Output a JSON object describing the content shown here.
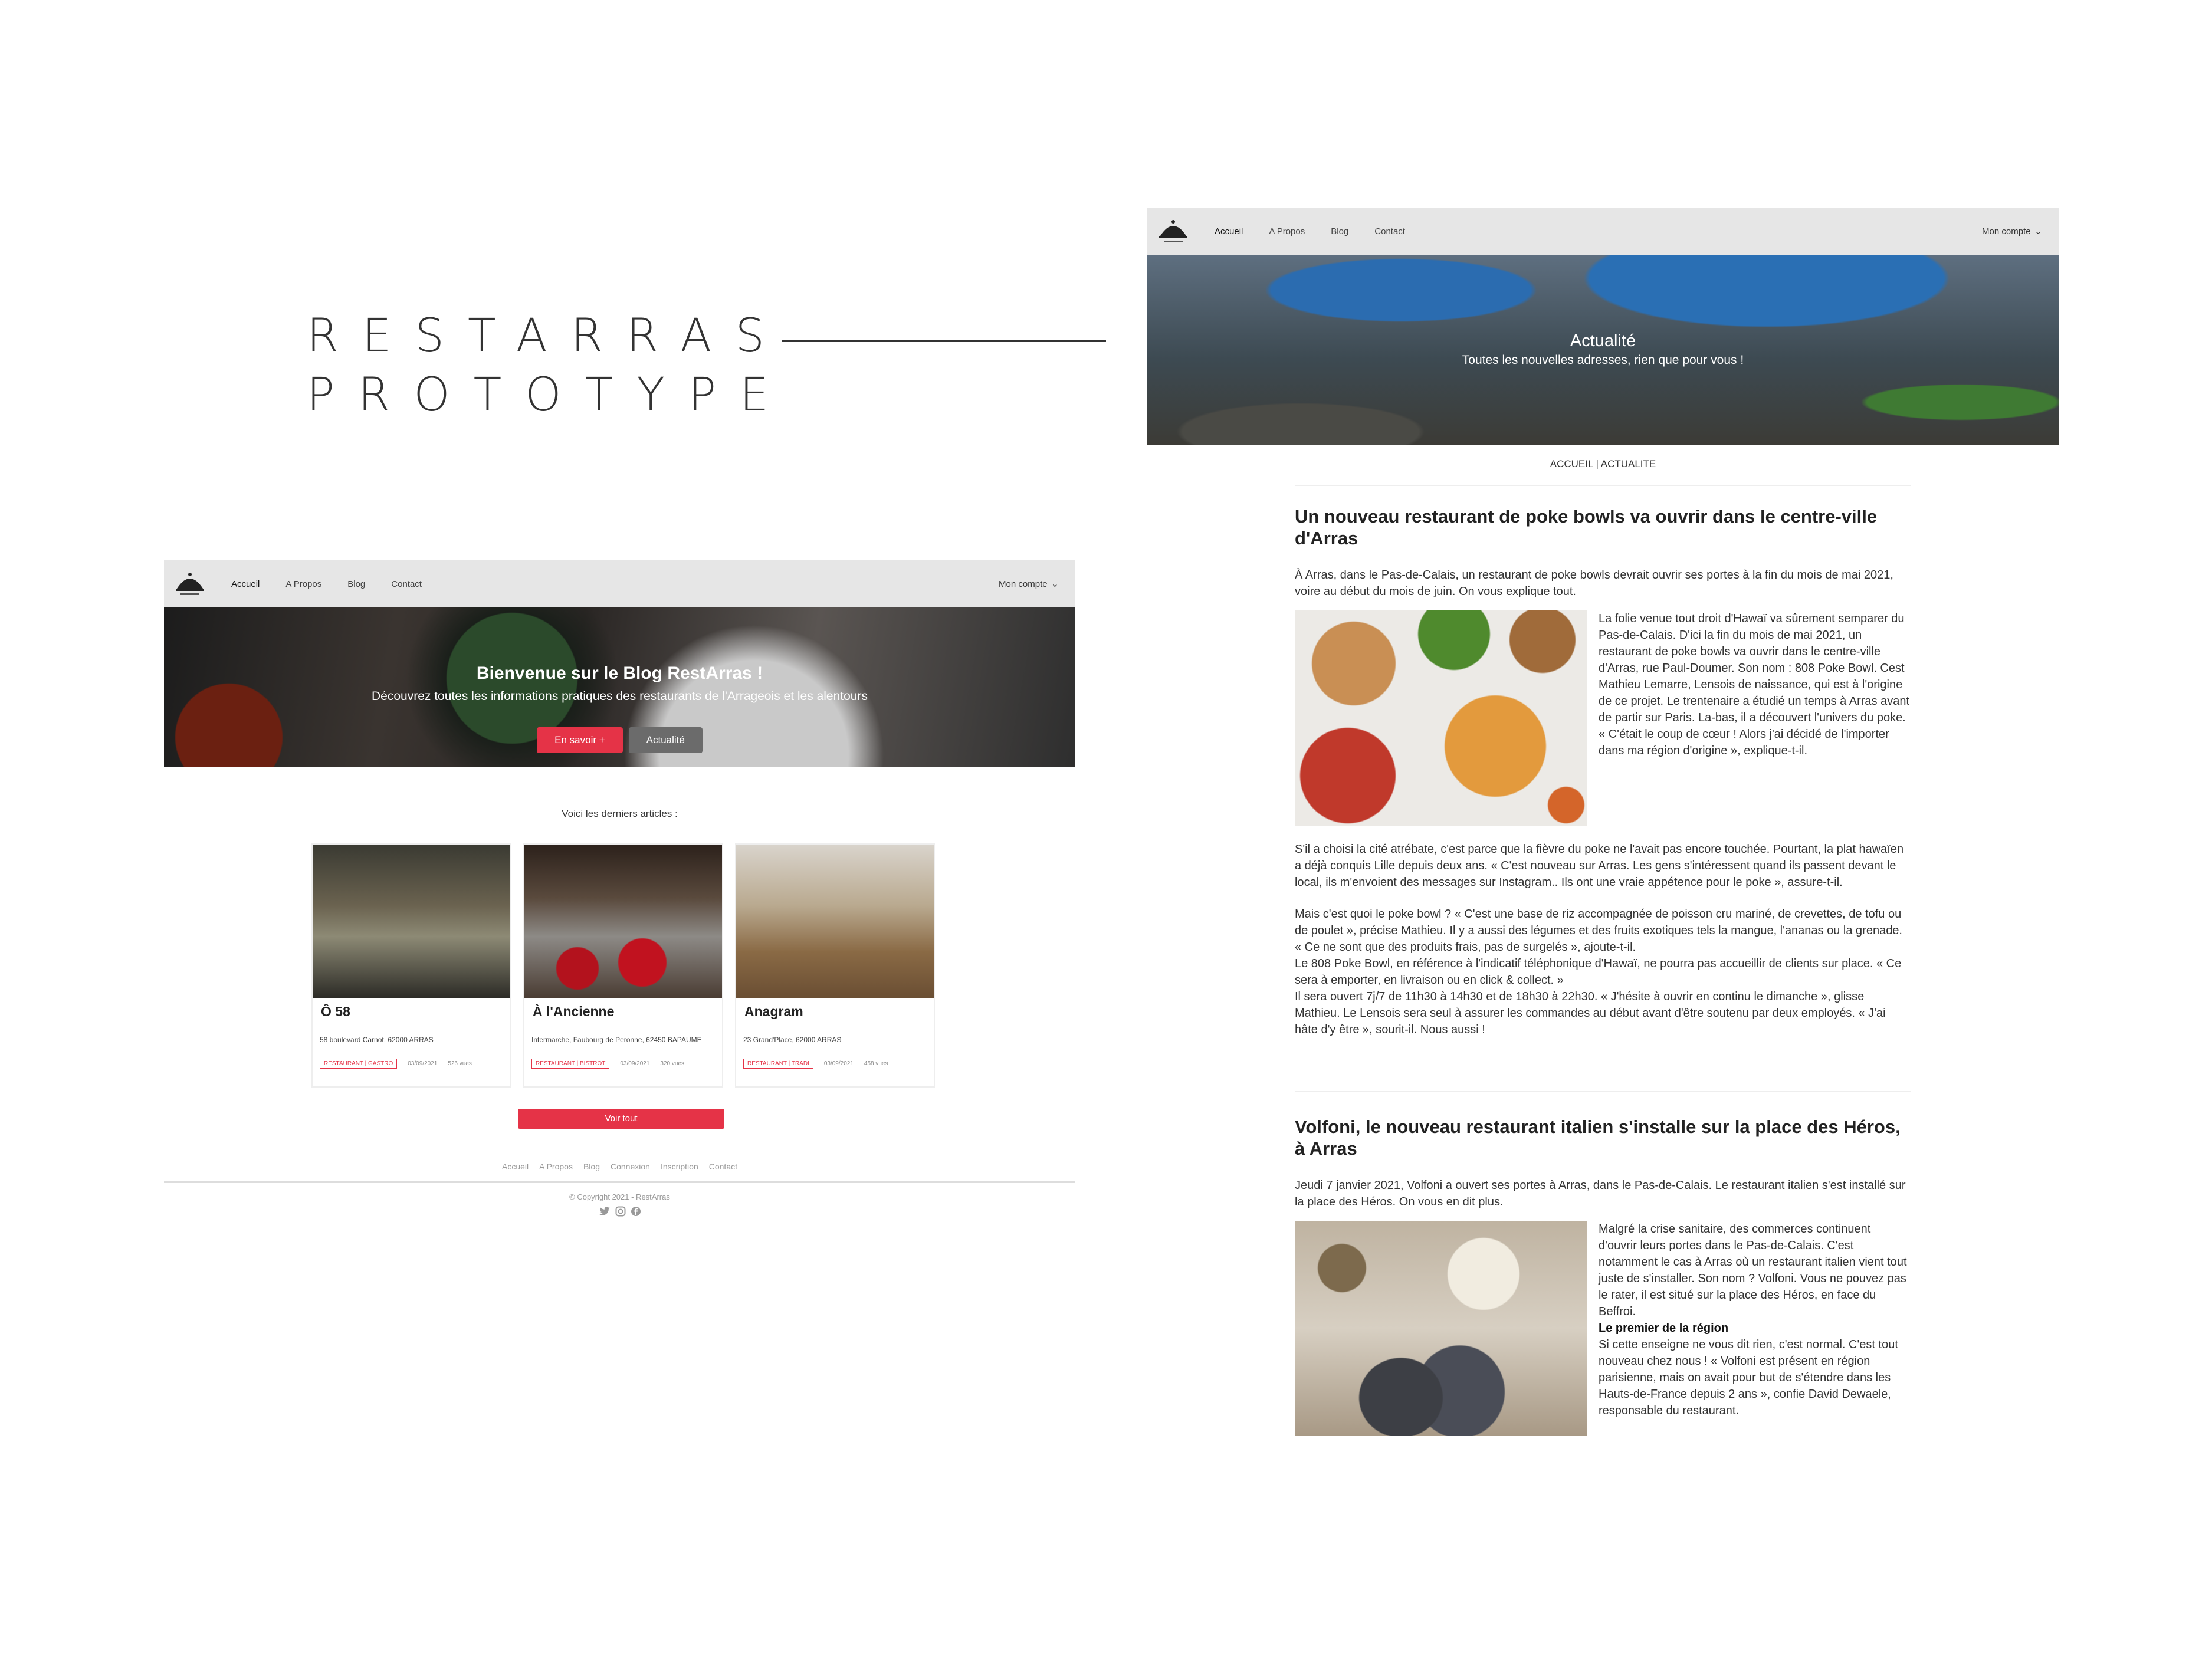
{
  "presentation": {
    "title_line1": "RESTARRAS",
    "title_line2": "PROTOTYPE"
  },
  "nav": {
    "items": [
      "Accueil",
      "A Propos",
      "Blog",
      "Contact"
    ],
    "account": "Mon compte"
  },
  "home": {
    "hero_title": "Bienvenue sur le Blog RestArras !",
    "hero_subtitle": "Découvrez toutes les informations pratiques des restaurants de l'Arrageois et les alentours",
    "btn_more": "En savoir +",
    "btn_news": "Actualité",
    "intro": "Voici les derniers articles :",
    "cards": [
      {
        "title": "Ô 58",
        "address": "58 boulevard Carnot, 62000 ARRAS",
        "tag": "RESTAURANT | GASTRO",
        "date": "03/09/2021",
        "views": "526 vues"
      },
      {
        "title": "À l'Ancienne",
        "address": "Intermarche, Faubourg de Peronne, 62450 BAPAUME",
        "tag": "RESTAURANT | BISTROT",
        "date": "03/09/2021",
        "views": "320 vues"
      },
      {
        "title": "Anagram",
        "address": "23 Grand'Place, 62000 ARRAS",
        "tag": "RESTAURANT | TRADI",
        "date": "03/09/2021",
        "views": "458 vues"
      }
    ],
    "btn_all": "Voir tout",
    "footer_links": [
      "Accueil",
      "A Propos",
      "Blog",
      "Connexion",
      "Inscription",
      "Contact"
    ],
    "copyright": "© Copyright 2021 - RestArras"
  },
  "news": {
    "hero_title": "Actualité",
    "hero_subtitle": "Toutes les nouvelles adresses, rien que pour vous !",
    "breadcrumb": "ACCUEIL | ACTUALITE",
    "article1": {
      "title": "Un nouveau restaurant de poke bowls va ouvrir dans le centre-ville d'Arras",
      "lead": "À Arras, dans le Pas-de-Calais, un restaurant de poke bowls devrait ouvrir ses portes à la fin du mois de mai 2021, voire au début du mois de juin. On vous explique tout.",
      "side": "La folie venue tout droit d'Hawaï va sûrement semparer du Pas-de-Calais. D'ici la fin du mois de mai 2021, un restaurant de poke bowls va ouvrir dans le centre-ville d'Arras, rue Paul-Doumer. Son nom : 808 Poke Bowl. Cest Mathieu Lemarre, Lensois de naissance, qui est à l'origine de ce projet. Le trentenaire a étudié un temps à Arras avant de partir sur Paris. La-bas, il a découvert l'univers du poke. « C'était le coup de cœur ! Alors j'ai décidé de l'importer dans ma région d'origine », explique-t-il.",
      "p1": "S'il a choisi la cité atrébate, c'est parce que la fièvre du poke ne l'avait pas encore touchée. Pourtant, la plat hawaïen a déjà conquis Lille depuis deux ans. « C'est nouveau sur Arras. Les gens s'intéressent quand ils passent devant le local, ils m'envoient des messages sur Instagram.. Ils ont une vraie appétence pour le poke », assure-t-il.",
      "p2": "Mais c'est quoi le poke bowl ? « C'est une base de riz accompagnée de poisson cru mariné, de crevettes, de tofu ou de poulet », précise Mathieu. Il y a aussi des légumes et des fruits exotiques tels la mangue, l'ananas ou la grenade. « Ce ne sont que des produits frais, pas de surgelés », ajoute-t-il.",
      "p3": "Le 808 Poke Bowl, en référence à l'indicatif téléphonique d'Hawaï, ne pourra pas accueillir de clients sur place. « Ce sera à emporter, en livraison ou en click & collect. »",
      "p4": "Il sera ouvert 7j/7 de 11h30 à 14h30 et de 18h30 à 22h30. « J'hésite à ouvrir en continu le dimanche », glisse Mathieu. Le Lensois sera seul à assurer les commandes au début avant d'être soutenu par deux employés. « J'ai hâte d'y être », sourit-il. Nous aussi !"
    },
    "article2": {
      "title": "Volfoni, le nouveau restaurant italien s'installe sur la place des Héros, à Arras",
      "lead": "Jeudi 7 janvier 2021, Volfoni a ouvert ses portes à Arras, dans le Pas-de-Calais. Le restaurant italien s'est installé sur la place des Héros. On vous en dit plus.",
      "side": "Malgré la crise sanitaire, des commerces continuent d'ouvrir leurs portes dans le Pas-de-Calais. C'est notamment le cas à Arras où un restaurant italien vient tout juste de s'installer. Son nom ? Volfoni. Vous ne pouvez pas le rater, il est situé sur la place des Héros, en face du Beffroi.",
      "subhead": "Le premier de la région",
      "side2": "Si cette enseigne ne vous dit rien, c'est normal. C'est tout nouveau chez nous ! « Volfoni est présent en région parisienne, mais on avait pour but de s'étendre dans les Hauts-de-France depuis 2 ans », confie David Dewaele, responsable du restaurant."
    }
  },
  "colors": {
    "accent": "#e53347",
    "nav_bg": "#e6e6e6"
  }
}
